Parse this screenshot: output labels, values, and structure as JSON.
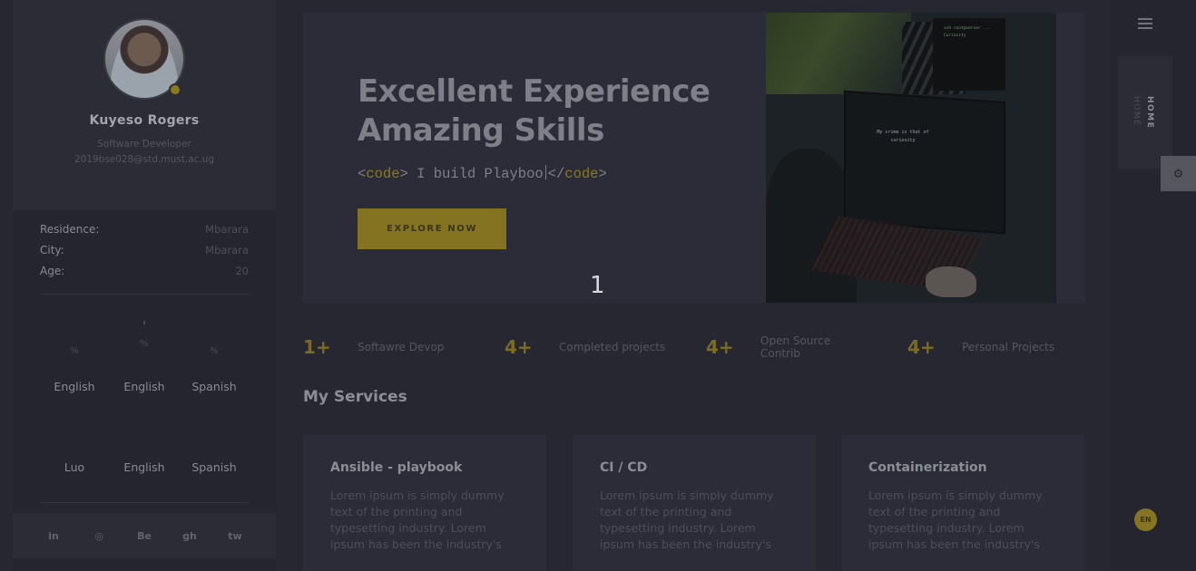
{
  "profile": {
    "name": "Kuyeso Rogers",
    "role": "Software Developer",
    "email": "2019bse028@std.must.ac.ug"
  },
  "info": [
    {
      "label": "Residence:",
      "value": "Mbarara"
    },
    {
      "label": "City:",
      "value": "Mbarara"
    },
    {
      "label": "Age:",
      "value": "20"
    }
  ],
  "languages_row1": [
    {
      "pct": "%",
      "name": "English"
    },
    {
      "pct": "%",
      "name": "English"
    },
    {
      "pct": "%",
      "name": "Spanish"
    }
  ],
  "languages_row2": [
    {
      "name": "Luo"
    },
    {
      "name": "English"
    },
    {
      "name": "Spanish"
    }
  ],
  "social": [
    "in",
    "◎",
    "Be",
    "gh",
    "tw"
  ],
  "hero": {
    "title_line1": "Excellent Experience",
    "title_line2": "Amazing Skills",
    "code_open": "<code>",
    "code_text": " I build Playboo",
    "code_close": "</code>",
    "code_tag_open_lt": "<",
    "code_tag_word": "code",
    "code_tag_gt": ">",
    "explore_label": "EXPLORE NOW",
    "image_text": "My crime is that of curiosity",
    "image_text2": "ssh root@server ... Curiosity"
  },
  "page_number": "1",
  "stats": [
    {
      "num": "1+",
      "label": "Softawre Devop"
    },
    {
      "num": "4+",
      "label": "Completed projects"
    },
    {
      "num": "4+",
      "label": "Open Source Contrib"
    },
    {
      "num": "4+",
      "label": "Personal Projects"
    }
  ],
  "services": {
    "title": "My Services",
    "items": [
      {
        "name": "Ansible - playbook",
        "text": "Lorem ipsum is simply dummy text of the printing and typesetting industry. Lorem ipsum has been the industry's"
      },
      {
        "name": "CI / CD",
        "text": "Lorem ipsum is simply dummy text of the printing and typesetting industry. Lorem ipsum has been the industry's"
      },
      {
        "name": "Containerization",
        "text": "Lorem ipsum is simply dummy text of the printing and typesetting industry. Lorem ipsum has been the industry's"
      }
    ]
  },
  "nav": {
    "home_label": "HOME",
    "lang_badge": "EN",
    "settings_icon": "gear-icon",
    "menu_icon": "menu-icon"
  },
  "colors": {
    "accent": "#847421",
    "background": "#262731",
    "card": "#2b2c37"
  }
}
